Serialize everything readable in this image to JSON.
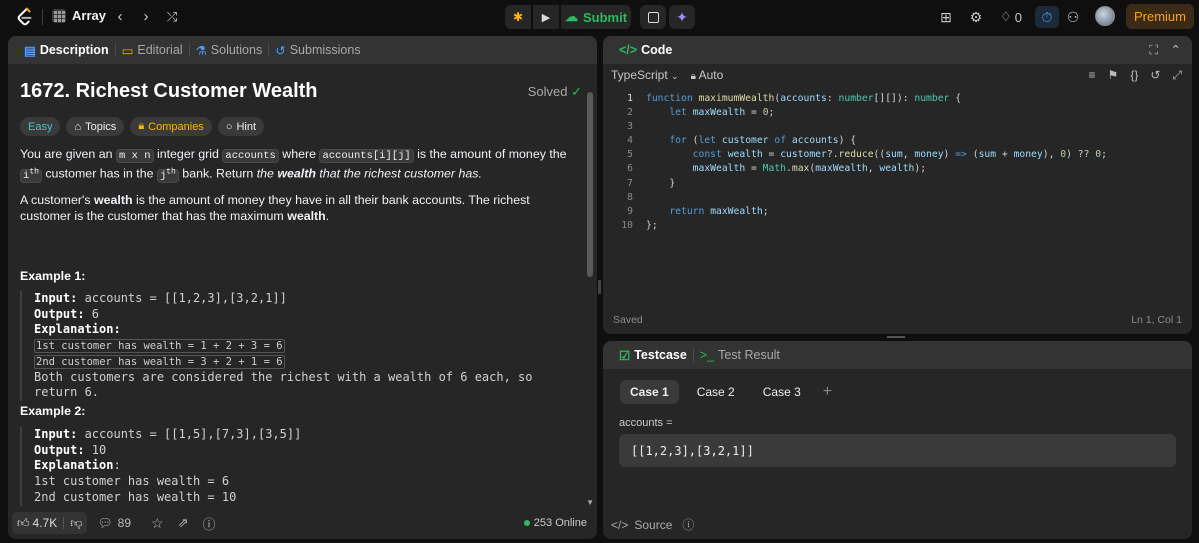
{
  "topbar": {
    "list_title": "Array",
    "submit_label": "Submit",
    "streak_count": "0",
    "premium_label": "Premium"
  },
  "left": {
    "tabs": [
      "Description",
      "Editorial",
      "Solutions",
      "Submissions"
    ],
    "title": "1672. Richest Customer Wealth",
    "solved": "Solved",
    "tags": [
      "Easy",
      "Topics",
      "Companies",
      "Hint"
    ],
    "p1_parts": [
      "You are given an ",
      "m x n",
      " integer grid ",
      "accounts",
      " where ",
      "accounts[i][j]",
      " is the amount of money the ",
      "i",
      "th",
      " customer has in the ",
      "j",
      "th",
      " bank. Return ",
      "the ",
      "wealth",
      " that the richest customer has."
    ],
    "p2_parts": [
      "A customer's ",
      "wealth",
      " is the amount of money they have in all their bank accounts. The richest customer is the customer that has the maximum ",
      "wealth",
      "."
    ],
    "example1": {
      "heading": "Example 1:",
      "input_label": "Input:",
      "input_value": " accounts = [[1,2,3],[3,2,1]]",
      "output_label": "Output:",
      "output_value": " 6",
      "explanation_label": "Explanation:",
      "lines": [
        "1st customer has wealth = 1 + 2 + 3 = 6",
        "2nd customer has wealth = 3 + 2 + 1 = 6"
      ],
      "conclusion": "Both customers are considered the richest with a wealth of 6 each, so return 6."
    },
    "example2": {
      "heading": "Example 2:",
      "input_label": "Input:",
      "input_value": " accounts = [[1,5],[7,3],[3,5]]",
      "output_label": "Output:",
      "output_value": " 10",
      "explanation_label": "Explanation",
      "explanation_colon": ":",
      "lines": [
        "1st customer has wealth = 6",
        "2nd customer has wealth = 10"
      ]
    },
    "footer": {
      "likes": "4.7K",
      "comments": "89",
      "online": "253 Online"
    }
  },
  "code": {
    "title": "Code",
    "language": "TypeScript",
    "mode": "Auto",
    "saved": "Saved",
    "cursor": "Ln 1, Col 1",
    "line_numbers": [
      "1",
      "2",
      "3",
      "4",
      "5",
      "6",
      "7",
      "8",
      "9",
      "10"
    ]
  },
  "testcase": {
    "tabs": [
      "Testcase",
      "Test Result"
    ],
    "cases": [
      "Case 1",
      "Case 2",
      "Case 3"
    ],
    "var_label": "accounts =",
    "var_value": "[[1,2,3],[3,2,1]]",
    "source_label": "Source"
  },
  "colors": {
    "accent": "#ffa116",
    "green": "#2cbb5d",
    "blue": "#4a9eff"
  }
}
